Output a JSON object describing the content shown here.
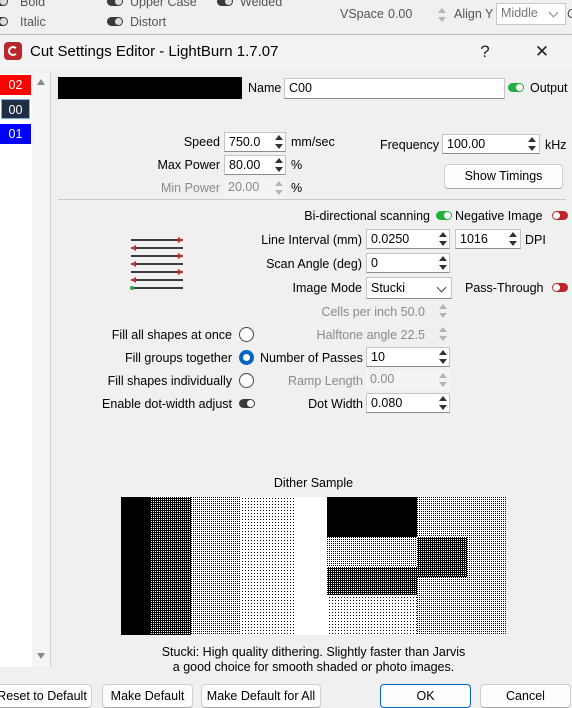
{
  "background_toolbar": {
    "bold": "Bold",
    "italic": "Italic",
    "upper_case": "Upper Case",
    "distort": "Distort",
    "welded": "Welded",
    "vspace_label": "VSpace",
    "vspace_value": "0.00",
    "align_y_label": "Align Y",
    "align_y_value": "Middle",
    "cut_off": "C"
  },
  "window": {
    "title": "Cut Settings Editor - LightBurn 1.7.07",
    "help_button": "?",
    "close_button": "✕"
  },
  "layers": [
    {
      "label": "02",
      "color": "#ff0000"
    },
    {
      "label": "00",
      "color": "#1f2e44"
    },
    {
      "label": "01",
      "color": "#0000ff"
    }
  ],
  "header": {
    "name_label": "Name",
    "name_value": "C00",
    "output_label": "Output"
  },
  "power": {
    "speed_label": "Speed",
    "speed_value": "750.0",
    "speed_unit": "mm/sec",
    "max_power_label": "Max Power",
    "max_power_value": "80.00",
    "min_power_label": "Min Power",
    "min_power_value": "20.00",
    "percent": "%",
    "frequency_label": "Frequency",
    "frequency_value": "100.00",
    "frequency_unit": "kHz",
    "show_timings": "Show Timings"
  },
  "image": {
    "bidir_label": "Bi-directional scanning",
    "negative_label": "Negative Image",
    "line_interval_label": "Line Interval (mm)",
    "line_interval_value": "0.0250",
    "dpi_value": "1016",
    "dpi_label": "DPI",
    "scan_angle_label": "Scan Angle (deg)",
    "scan_angle_value": "0",
    "image_mode_label": "Image Mode",
    "image_mode_value": "Stucki",
    "pass_through_label": "Pass-Through",
    "cells_label": "Cells per inch",
    "cells_value": "50.0",
    "halftone_label": "Halftone angle",
    "halftone_value": "22.5",
    "passes_label": "Number of Passes",
    "passes_value": "10",
    "ramp_label": "Ramp Length",
    "ramp_value": "0.00",
    "dot_width_label": "Dot Width",
    "dot_width_value": "0.080",
    "fill_all": "Fill all shapes at once",
    "fill_groups": "Fill groups together",
    "fill_individual": "Fill shapes individually",
    "dot_width_adjust": "Enable dot-width adjust"
  },
  "dither": {
    "title": "Dither Sample",
    "desc_line1": "Stucki: High quality dithering. Slightly faster than Jarvis",
    "desc_line2": "a good choice for smooth shaded or photo images."
  },
  "footer": {
    "reset": "Reset to Default",
    "make_default": "Make Default",
    "make_default_all": "Make Default for All",
    "ok": "OK",
    "cancel": "Cancel"
  }
}
